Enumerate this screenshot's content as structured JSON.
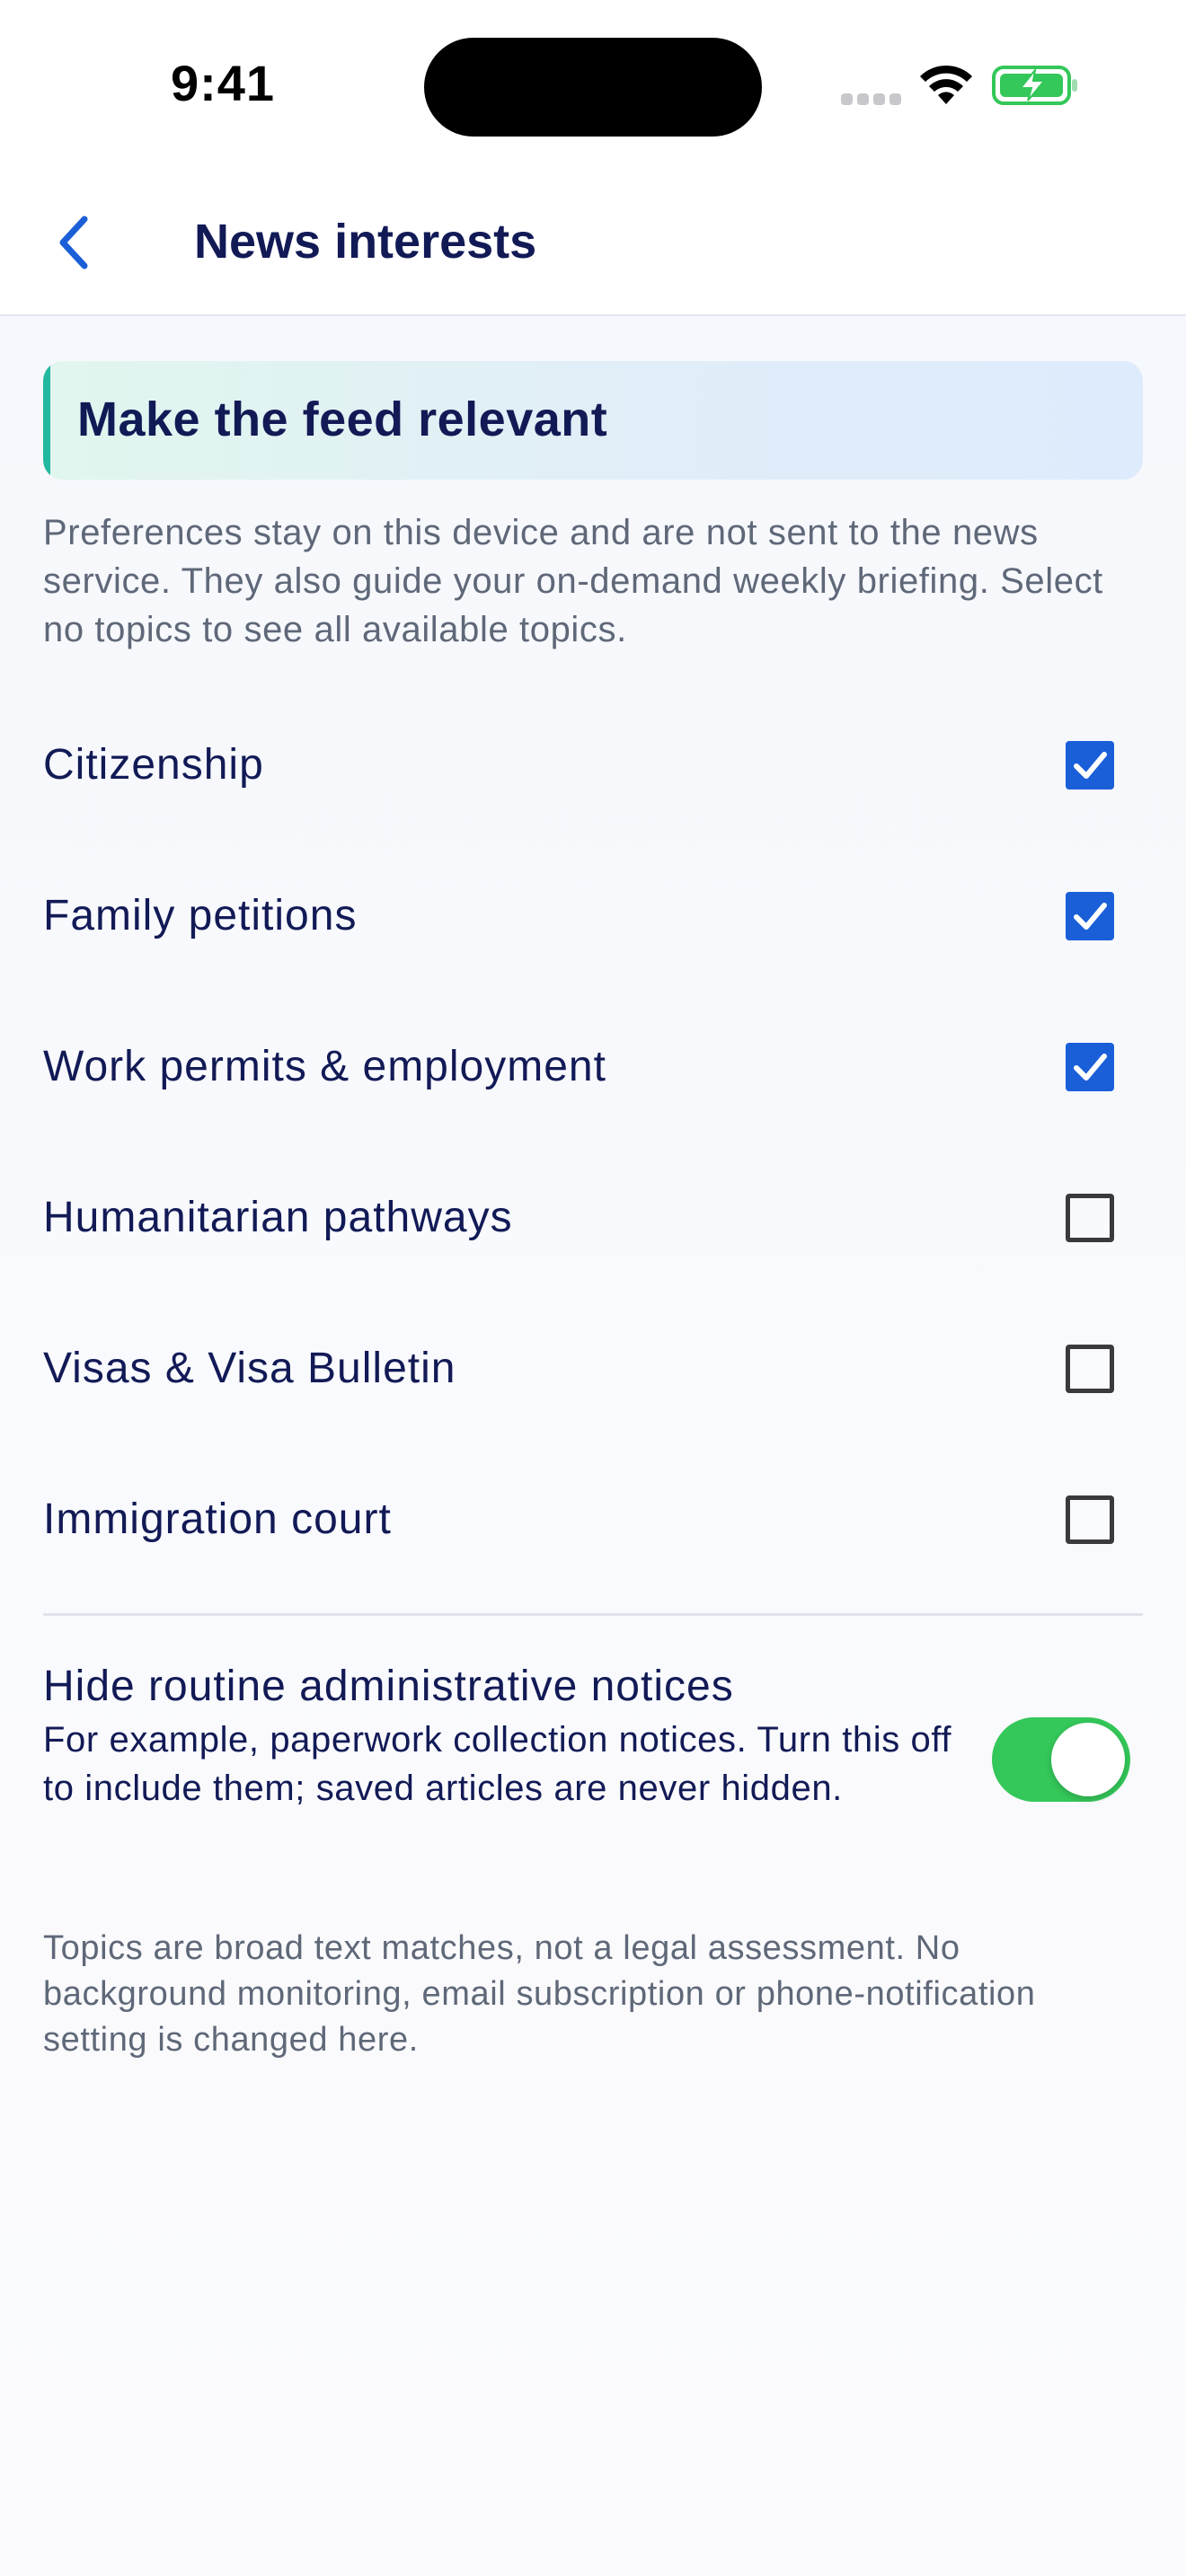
{
  "status_bar": {
    "time": "9:41",
    "icons": [
      "signal-icon",
      "wifi-icon",
      "battery-charging-icon"
    ]
  },
  "nav": {
    "back_icon": "chevron-left-icon",
    "title": "News interests"
  },
  "banner": {
    "title": "Make the feed relevant"
  },
  "intro": "Preferences stay on this device and are not sent to the news service. They also guide your on-demand weekly briefing. Select no topics to see all available topics.",
  "topics": [
    {
      "label": "Citizenship",
      "checked": true
    },
    {
      "label": "Family petitions",
      "checked": true
    },
    {
      "label": "Work permits & employment",
      "checked": true
    },
    {
      "label": "Humanitarian pathways",
      "checked": false
    },
    {
      "label": "Visas & Visa Bulletin",
      "checked": false
    },
    {
      "label": "Immigration court",
      "checked": false
    }
  ],
  "hide_notices": {
    "title": "Hide routine administrative notices",
    "description": "For example, paperwork collection notices. Turn this off to include them; saved articles are never hidden.",
    "enabled": true
  },
  "footnote": "Topics are broad text matches, not a legal assessment. No background monitoring, email subscription or phone-notification setting is changed here.",
  "colors": {
    "accent_blue": "#1a5fd8",
    "toggle_green": "#34c759",
    "banner_accent": "#22b8a0",
    "text_primary": "#121a56",
    "text_secondary": "#5f6878"
  }
}
